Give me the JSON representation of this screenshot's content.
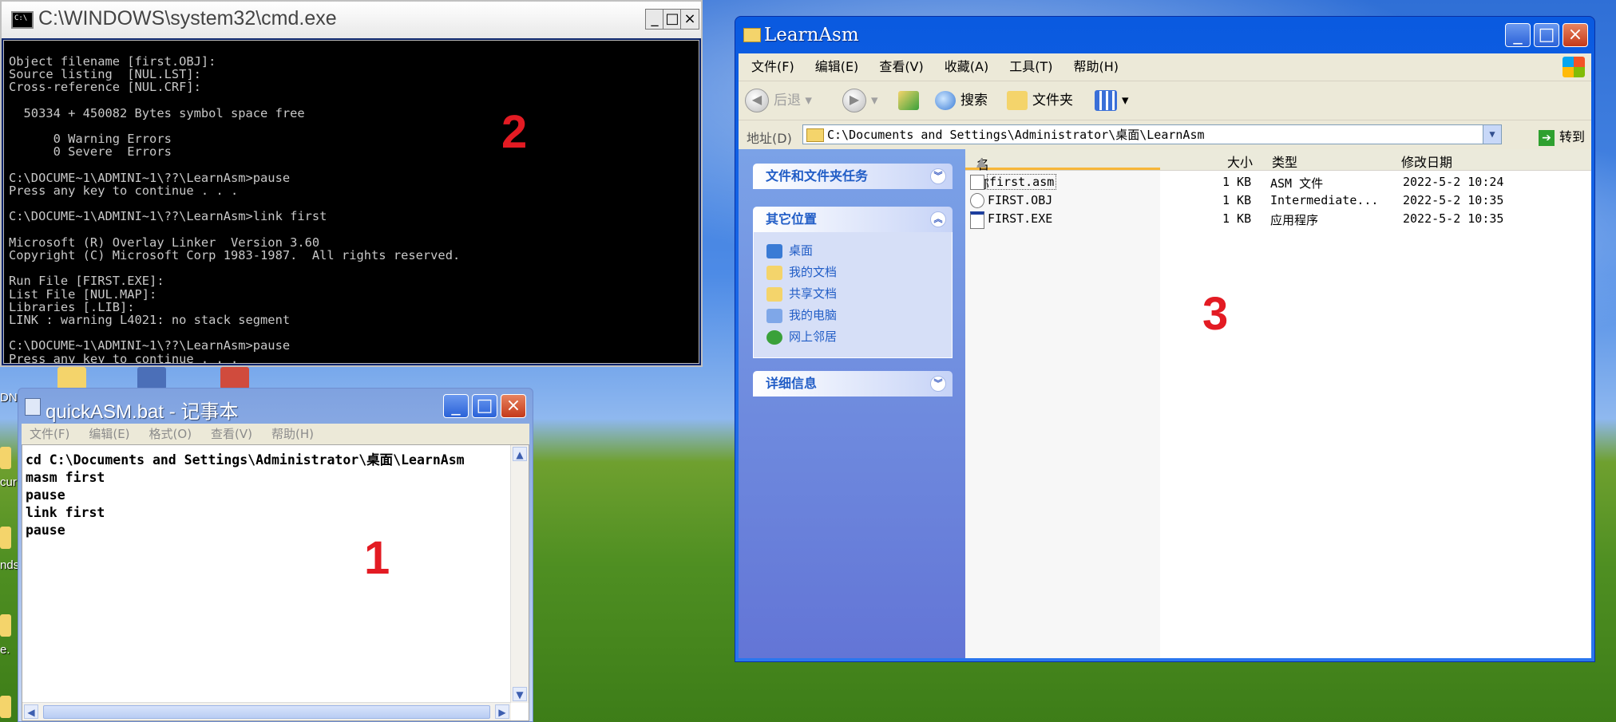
{
  "annotations": {
    "n1": "1",
    "n2": "2",
    "n3": "3"
  },
  "desktop_fragments": [
    "DN",
    "cur",
    "nds",
    "e."
  ],
  "cmd": {
    "title": "C:\\WINDOWS\\system32\\cmd.exe",
    "icon_label": "C:\\",
    "lines": [
      "Object filename [first.OBJ]:",
      "Source listing  [NUL.LST]:",
      "Cross-reference [NUL.CRF]:",
      "",
      "  50334 + 450082 Bytes symbol space free",
      "",
      "      0 Warning Errors",
      "      0 Severe  Errors",
      "",
      "C:\\DOCUME~1\\ADMINI~1\\??\\LearnAsm>pause",
      "Press any key to continue . . .",
      "",
      "C:\\DOCUME~1\\ADMINI~1\\??\\LearnAsm>link first",
      "",
      "Microsoft (R) Overlay Linker  Version 3.60",
      "Copyright (C) Microsoft Corp 1983-1987.  All rights reserved.",
      "",
      "Run File [FIRST.EXE]:",
      "List File [NUL.MAP]:",
      "Libraries [.LIB]:",
      "LINK : warning L4021: no stack segment",
      "",
      "C:\\DOCUME~1\\ADMINI~1\\??\\LearnAsm>pause",
      "Press any key to continue . . ."
    ]
  },
  "notepad": {
    "title": "quickASM.bat - 记事本",
    "menu": [
      "文件(F)",
      "编辑(E)",
      "格式(O)",
      "查看(V)",
      "帮助(H)"
    ],
    "content_lines": [
      "cd C:\\Documents and Settings\\Administrator\\桌面\\LearnAsm",
      "masm first",
      "pause",
      "link first",
      "pause"
    ]
  },
  "explorer": {
    "title": "LearnAsm",
    "menu": [
      "文件(F)",
      "编辑(E)",
      "查看(V)",
      "收藏(A)",
      "工具(T)",
      "帮助(H)"
    ],
    "toolbar": {
      "back": "后退",
      "search": "搜索",
      "folders": "文件夹"
    },
    "address": {
      "label": "地址(D)",
      "path": "C:\\Documents and Settings\\Administrator\\桌面\\LearnAsm",
      "go": "转到"
    },
    "tasks": {
      "file_tasks": "文件和文件夹任务",
      "other_places": "其它位置",
      "places": [
        "桌面",
        "我的文档",
        "共享文档",
        "我的电脑",
        "网上邻居"
      ],
      "details": "详细信息"
    },
    "columns": {
      "name": "名称",
      "size": "大小",
      "type": "类型",
      "modified": "修改日期"
    },
    "files": [
      {
        "name": "first.asm",
        "size": "1 KB",
        "type": "ASM 文件",
        "modified": "2022-5-2 10:24"
      },
      {
        "name": "FIRST.OBJ",
        "size": "1 KB",
        "type": "Intermediate...",
        "modified": "2022-5-2 10:35"
      },
      {
        "name": "FIRST.EXE",
        "size": "1 KB",
        "type": "应用程序",
        "modified": "2022-5-2 10:35"
      }
    ]
  }
}
